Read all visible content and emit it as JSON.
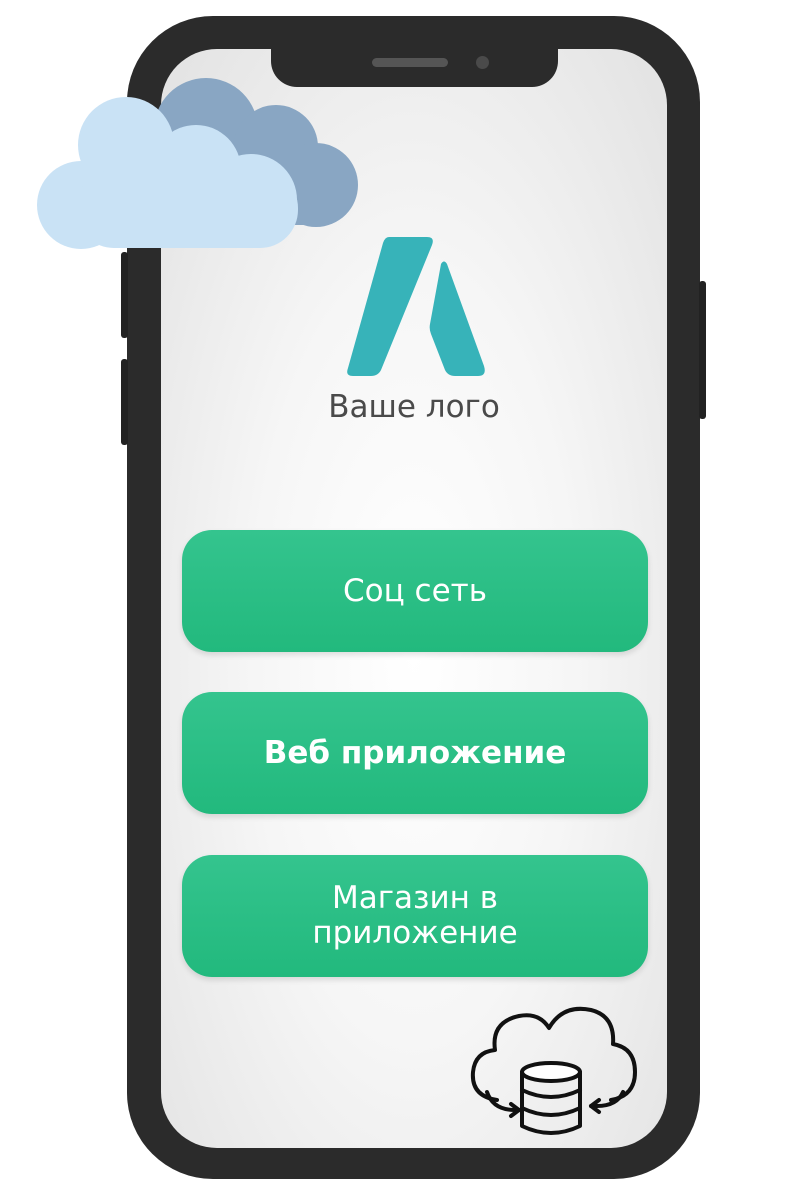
{
  "logo": {
    "icon": "stylized-a-logo-icon",
    "caption": "Ваше лого",
    "color": "#37b3b9"
  },
  "menu": {
    "buttons": [
      {
        "label": "Соц сеть",
        "bold": false
      },
      {
        "label": "Веб приложение",
        "bold": true
      },
      {
        "label": "Магазин в\nприложение",
        "bold": false
      }
    ],
    "accent": "#2bc088"
  },
  "decor": {
    "cloud_icon": "cloud-icon",
    "cloud_front": "#c9e2f5",
    "cloud_back": "#89a6c3",
    "database_icon": "cloud-database-sync-icon"
  }
}
